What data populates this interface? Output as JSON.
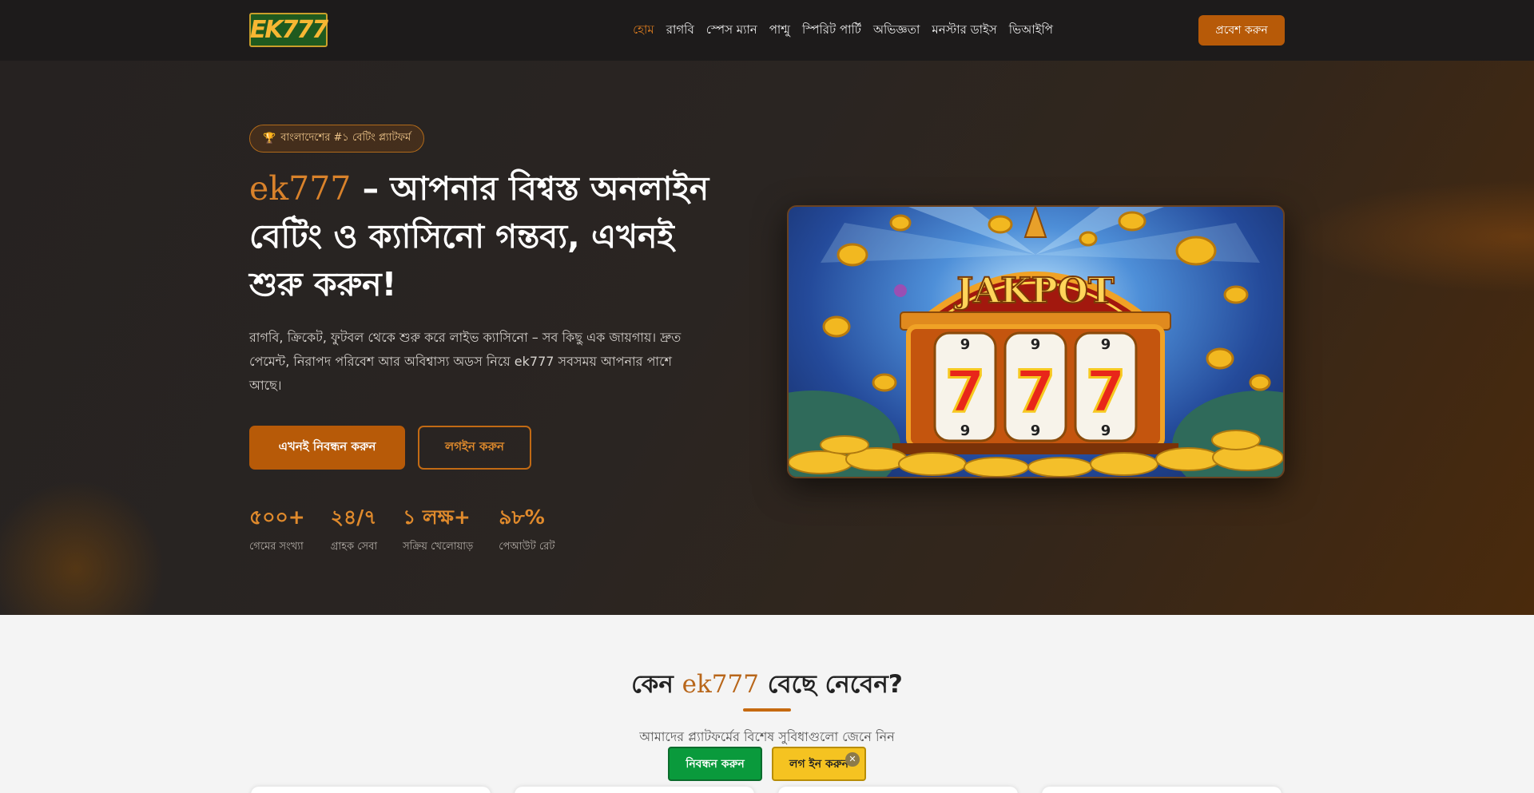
{
  "header": {
    "logo_text": "EK777",
    "nav": [
      {
        "label": "হোম",
        "active": true
      },
      {
        "label": "রাগবি"
      },
      {
        "label": "স্পেস ম্যান"
      },
      {
        "label": "পাশ্মু"
      },
      {
        "label": "স্পিরিট পার্টি"
      },
      {
        "label": "অভিজ্ঞতা"
      },
      {
        "label": "মনস্টার ডাইস"
      },
      {
        "label": "ভিআইপি"
      }
    ],
    "enter_button": "প্রবেশ করুন"
  },
  "hero": {
    "badge_icon": "🏆",
    "badge_text": "বাংলাদেশের #১ বেটিং প্ল্যাটফর্ম",
    "title_brand": "ek777",
    "title_rest": " – আপনার বিশ্বস্ত অনলাইন বেটিং ও ক্যাসিনো গন্তব্য, এখনই শুরু করুন!",
    "description": "রাগবি, ক্রিকেট, ফুটবল থেকে শুরু করে লাইভ ক্যাসিনো – সব কিছু এক জায়গায়। দ্রুত পেমেন্ট, নিরাপদ পরিবেশ আর অবিশ্বাস্য অডস নিয়ে ek777 সবসময় আপনার পাশে আছে।",
    "register_button": "এখনই নিবন্ধন করুন",
    "login_button": "লগইন করুন",
    "stats": [
      {
        "value": "৫০০+",
        "label": "গেমের সংখ্যা"
      },
      {
        "value": "২৪/৭",
        "label": "গ্রাহক সেবা"
      },
      {
        "value": "১ লক্ষ+",
        "label": "সক্রিয় খেলোয়াড়"
      },
      {
        "value": "৯৮%",
        "label": "পেআউট রেট"
      }
    ],
    "image": {
      "banner_text": "JAKPOT",
      "reel_symbols": [
        "7",
        "7",
        "7"
      ],
      "reel_small_numbers": [
        "9",
        "9",
        "9",
        "9",
        "9",
        "9"
      ]
    }
  },
  "features": {
    "title_prefix": "কেন ",
    "title_brand": "ek777",
    "title_suffix": " বেছে নেবেন?",
    "subtitle": "আমাদের প্ল্যাটফর্মের বিশেষ সুবিধাগুলো জেনে নিন"
  },
  "floating": {
    "register_button": "নিবন্ধন করুন",
    "login_button": "লগ ইন করুন",
    "close_icon": "✕"
  },
  "colors": {
    "accent": "#b75a08",
    "accent_text": "#e08a2c",
    "header_bg": "#1d1b1b",
    "float_register": "#0a9a3c",
    "float_login": "#f5c321"
  }
}
